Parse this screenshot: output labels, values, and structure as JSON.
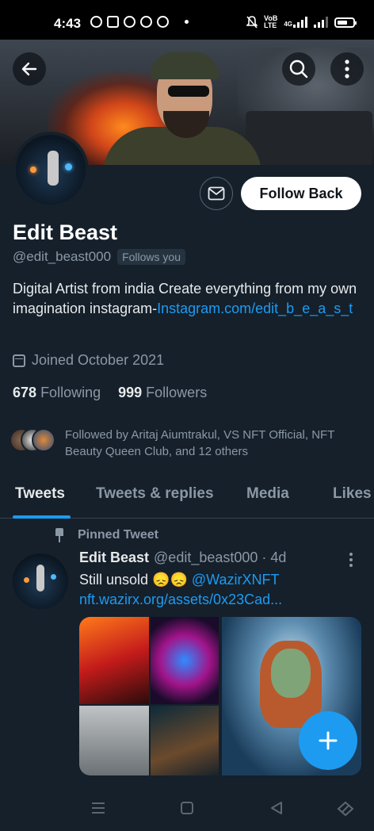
{
  "status_bar": {
    "time": "4:43",
    "net_label_top": "VoB",
    "net_label_bottom": "LTE",
    "net_type": "4G"
  },
  "profile": {
    "name": "Edit Beast",
    "handle": "@edit_beast000",
    "follows_you": "Follows you",
    "bio_text": "Digital Artist from india Create everything from my own imagination instagram-",
    "bio_link": "Instagram.com/edit_b_e_a_s_t",
    "joined": "Joined October 2021",
    "following_count": "678",
    "following_label": "Following",
    "followers_count": "999",
    "followers_label": "Followers",
    "followed_by": "Followed by Aritaj Aiumtrakul, VS NFT Official, NFT Beauty Queen Club, and 12 others",
    "follow_button": "Follow Back"
  },
  "tabs": [
    "Tweets",
    "Tweets & replies",
    "Media",
    "Likes"
  ],
  "tweet": {
    "pinned_label": "Pinned Tweet",
    "name": "Edit Beast",
    "handle_time": "@edit_beast000 · 4d",
    "text": "Still unsold 😞😞 ",
    "mention": "@WazirXNFT",
    "link": "nft.wazirx.org/assets/0x23Cad..."
  },
  "colors": {
    "background": "#15202b",
    "accent": "#1d9bf0",
    "secondary_text": "#8b98a5"
  },
  "icons": {
    "back": "arrow-left-icon",
    "search": "search-icon",
    "more": "more-vertical-icon",
    "message": "mail-icon",
    "calendar": "calendar-icon",
    "pin": "pin-icon",
    "compose": "plus-icon"
  }
}
